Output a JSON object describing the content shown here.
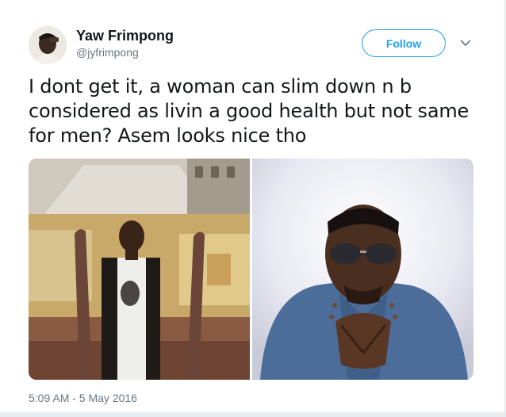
{
  "author": {
    "display_name": "Yaw Frimpong",
    "username": "@jyfrimpong",
    "avatar_icon": "avatar-photo"
  },
  "actions": {
    "follow_label": "Follow",
    "more_icon": "chevron-down-icon"
  },
  "tweet": {
    "text": "I dont get it, a woman can slim down n b considered as livin a good health but not same for men? Asem looks nice tho",
    "timestamp": "5:09 AM - 5 May 2016"
  },
  "media": {
    "photos": [
      "rooftop-portrait-photo",
      "sunglasses-portrait-photo"
    ]
  },
  "colors": {
    "accent": "#1da1f2",
    "secondary_text": "#657786",
    "primary_text": "#14171a"
  }
}
